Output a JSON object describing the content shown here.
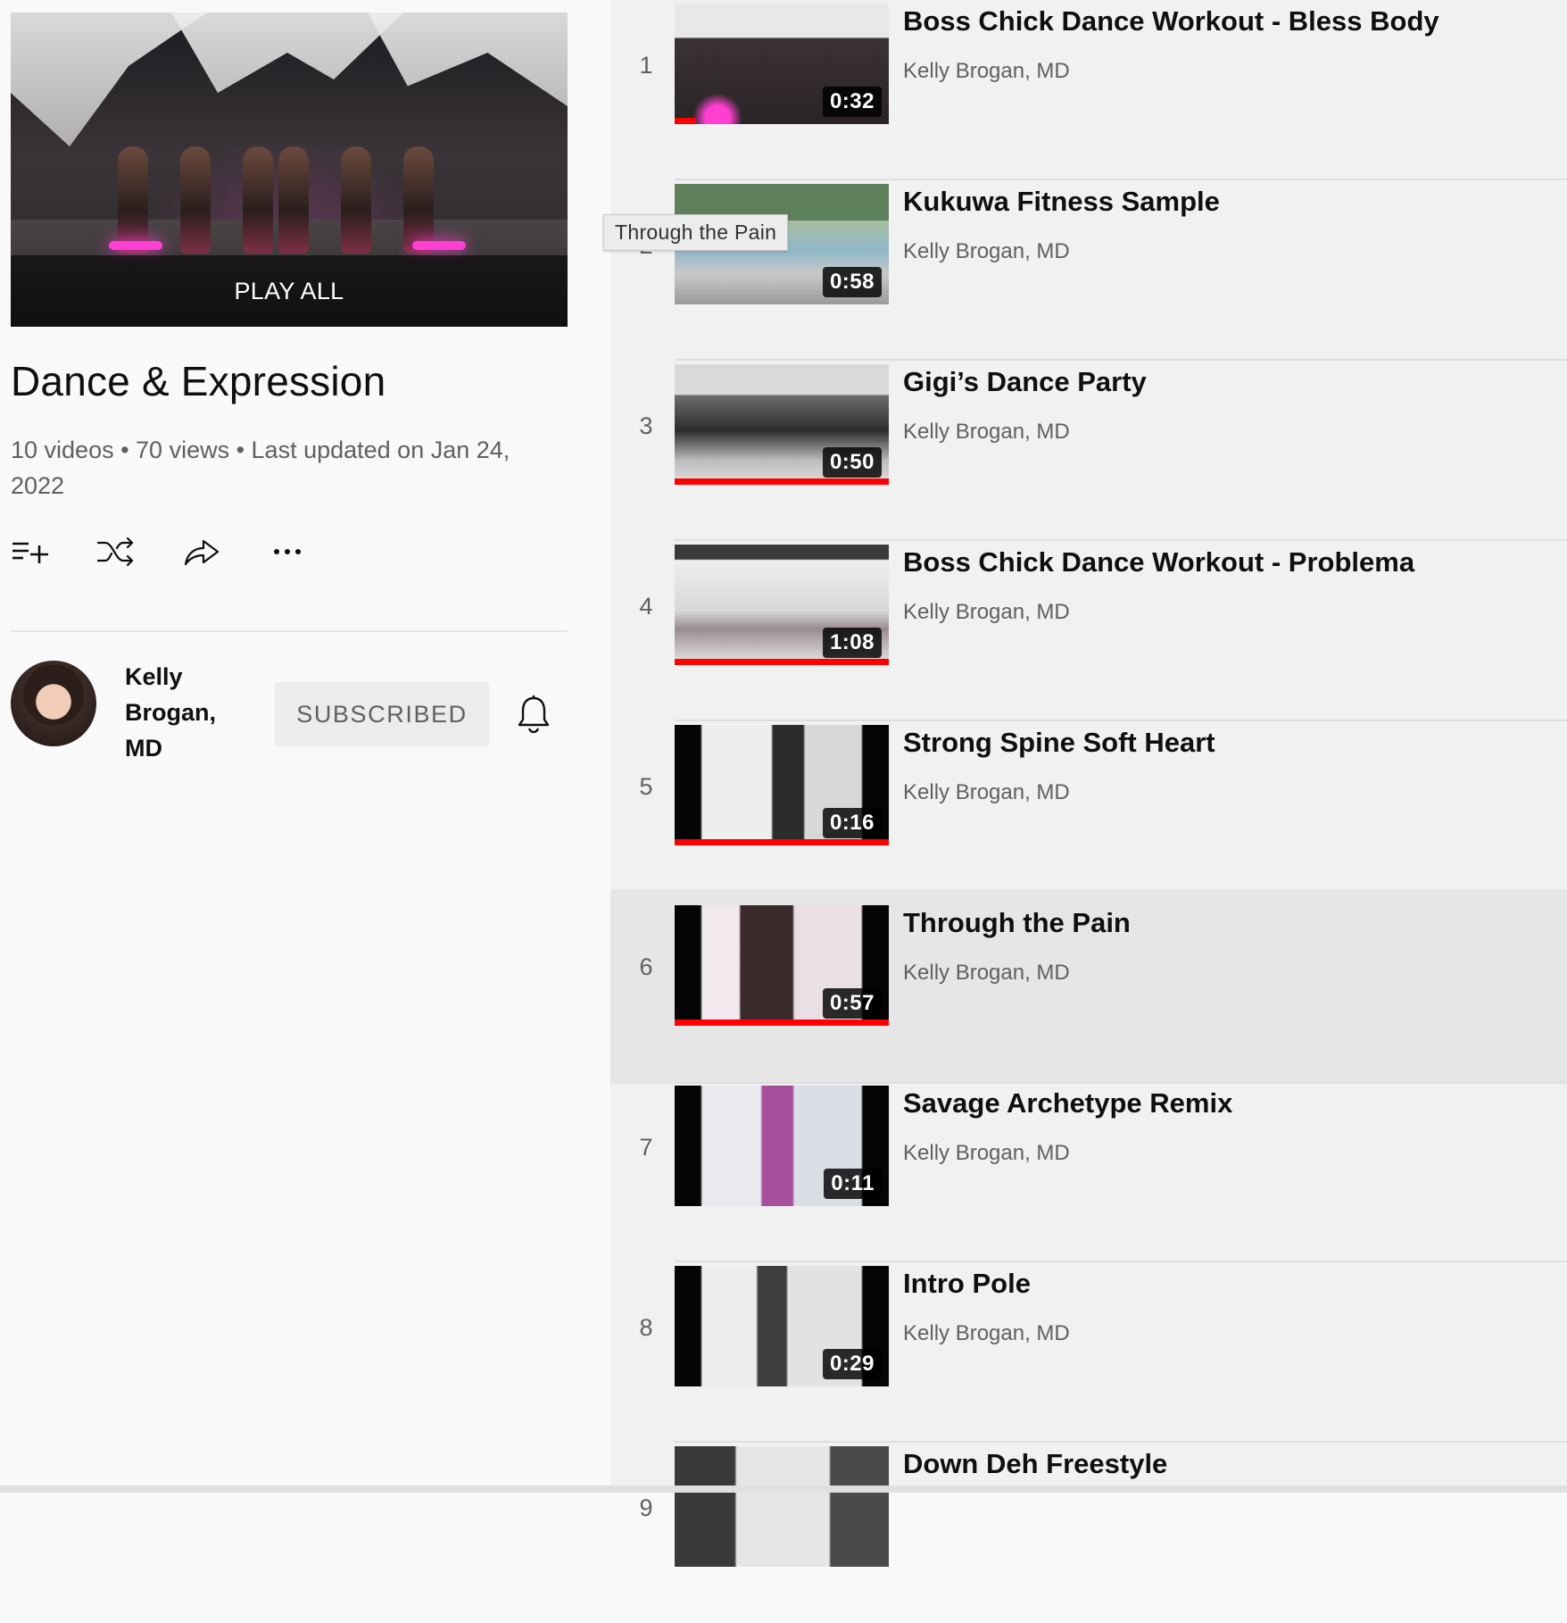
{
  "playlist": {
    "play_all_label": "PLAY ALL",
    "title": "Dance & Expression",
    "meta": "10 videos • 70 views • Last updated on Jan 24, 2022"
  },
  "actions": [
    {
      "icon": "add-to-queue-icon"
    },
    {
      "icon": "shuffle-icon"
    },
    {
      "icon": "share-icon"
    },
    {
      "icon": "more-icon"
    }
  ],
  "owner": {
    "name": "Kelly Brogan, MD",
    "subscribe_label": "SUBSCRIBED"
  },
  "tooltip": "Through the Pain",
  "videos": [
    {
      "index": "1",
      "title": "Boss Chick Dance Workout - Bless Body",
      "channel": "Kelly Brogan, MD",
      "duration": "0:32",
      "progress": 0.1
    },
    {
      "index": "2",
      "title": "Kukuwa Fitness Sample",
      "channel": "Kelly Brogan, MD",
      "duration": "0:58",
      "progress": 0
    },
    {
      "index": "3",
      "title": "Gigi’s Dance Party",
      "channel": "Kelly Brogan, MD",
      "duration": "0:50",
      "progress": 1
    },
    {
      "index": "4",
      "title": "Boss Chick Dance Workout - Problema",
      "channel": "Kelly Brogan, MD",
      "duration": "1:08",
      "progress": 1
    },
    {
      "index": "5",
      "title": "Strong Spine Soft Heart",
      "channel": "Kelly Brogan, MD",
      "duration": "0:16",
      "progress": 1
    },
    {
      "index": "6",
      "title": "Through the Pain",
      "channel": "Kelly Brogan, MD",
      "duration": "0:57",
      "progress": 1,
      "active": true
    },
    {
      "index": "7",
      "title": "Savage Archetype Remix",
      "channel": "Kelly Brogan, MD",
      "duration": "0:11",
      "progress": 0
    },
    {
      "index": "8",
      "title": "Intro Pole",
      "channel": "Kelly Brogan, MD",
      "duration": "0:29",
      "progress": 0
    },
    {
      "index": "9",
      "title": "Down Deh Freestyle",
      "channel": "",
      "duration": "",
      "progress": 0
    }
  ],
  "colors": {
    "progress_red": "#ff0000",
    "active_row": "#e6e6e6",
    "list_bg": "#f1f1f1"
  }
}
